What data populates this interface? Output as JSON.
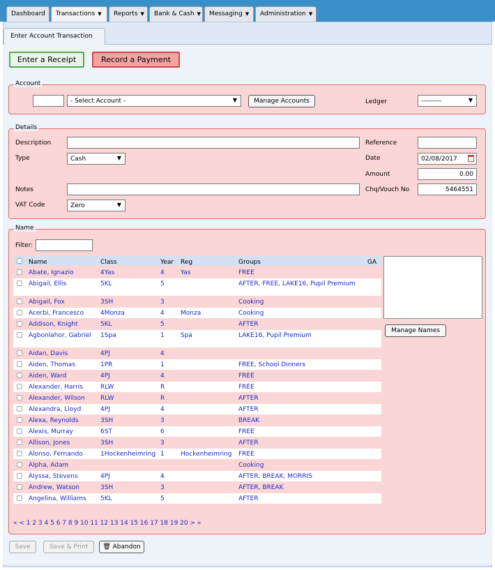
{
  "nav": {
    "tabs": [
      "Dashboard",
      "Transactions",
      "Reports",
      "Bank & Cash",
      "Messaging",
      "Administration"
    ]
  },
  "page_tab": "Enter Account Transaction",
  "buttons": {
    "receipt": "Enter a Receipt",
    "payment": "Record a Payment",
    "manage_accounts": "Manage Accounts",
    "manage_names": "Manage Names",
    "save": "Save",
    "save_print": "Save & Print",
    "abandon": "Abandon"
  },
  "account": {
    "legend": "Account",
    "account_code": "",
    "select_account": "- Select Account -",
    "ledger_label": "Ledger",
    "ledger_value": "---------"
  },
  "details": {
    "legend": "Details",
    "description_label": "Description",
    "description_value": "",
    "type_label": "Type",
    "type_value": "Cash",
    "notes_label": "Notes",
    "notes_value": "",
    "vat_label": "VAT Code",
    "vat_value": "Zero",
    "reference_label": "Reference",
    "reference_value": "",
    "date_label": "Date",
    "date_value": "02/08/2017",
    "amount_label": "Amount",
    "amount_value": "0.00",
    "chq_label": "Chq/Vouch No",
    "chq_value": "5464551"
  },
  "names": {
    "legend": "Name",
    "filter_label": "Filter:",
    "filter_value": "",
    "columns": [
      "Name",
      "Class",
      "Year",
      "Reg",
      "Groups",
      "GA"
    ],
    "rows": [
      [
        "Abate, Ignazio",
        "4Yas",
        "4",
        "Yas",
        "FREE"
      ],
      [
        "Abigail, Ellis",
        "5KL",
        "5",
        "",
        "AFTER, FREE, LAKE16, Pupil Premium"
      ],
      [
        "Abigail, Fox",
        "3SH",
        "3",
        "",
        "Cooking"
      ],
      [
        "Acerbi, Francesco",
        "4Monza",
        "4",
        "Monza",
        "Cooking"
      ],
      [
        "Addison, Knight",
        "5KL",
        "5",
        "",
        "AFTER"
      ],
      [
        "Agbonlahor, Gabriel",
        "1Spa",
        "1",
        "Spa",
        "LAKE16, Pupil Premium"
      ],
      [
        "Aidan, Davis",
        "4PJ",
        "4",
        "",
        ""
      ],
      [
        "Aiden, Thomas",
        "1PR",
        "1",
        "",
        "FREE, School Dinners"
      ],
      [
        "Aiden, Ward",
        "4PJ",
        "4",
        "",
        "FREE"
      ],
      [
        "Alexander, Harris",
        "RLW",
        "R",
        "",
        "FREE"
      ],
      [
        "Alexander, Wilson",
        "RLW",
        "R",
        "",
        "AFTER"
      ],
      [
        "Alexandra, Lloyd",
        "4PJ",
        "4",
        "",
        "AFTER"
      ],
      [
        "Alexa, Reynolds",
        "3SH",
        "3",
        "",
        "BREAK"
      ],
      [
        "Alexis, Murray",
        "6ST",
        "6",
        "",
        "FREE"
      ],
      [
        "Allison, Jones",
        "3SH",
        "3",
        "",
        "AFTER"
      ],
      [
        "Alonso, Fernando",
        "1Hockenheimring",
        "1",
        "Hockenheimring",
        "FREE"
      ],
      [
        "Alpha, Adam",
        "",
        "",
        "",
        "Cooking"
      ],
      [
        "Alyssa, Stevens",
        "4PJ",
        "4",
        "",
        "AFTER, BREAK, MORRIS"
      ],
      [
        "Andrew, Watson",
        "3SH",
        "3",
        "",
        "AFTER, BREAK"
      ],
      [
        "Angelina, Williams",
        "5KL",
        "5",
        "",
        "AFTER"
      ]
    ],
    "pager": "« < 1 2 3 4 5 6 7 8 9 10 11 12 13 14 15 16 17 18 19 20 > »"
  }
}
